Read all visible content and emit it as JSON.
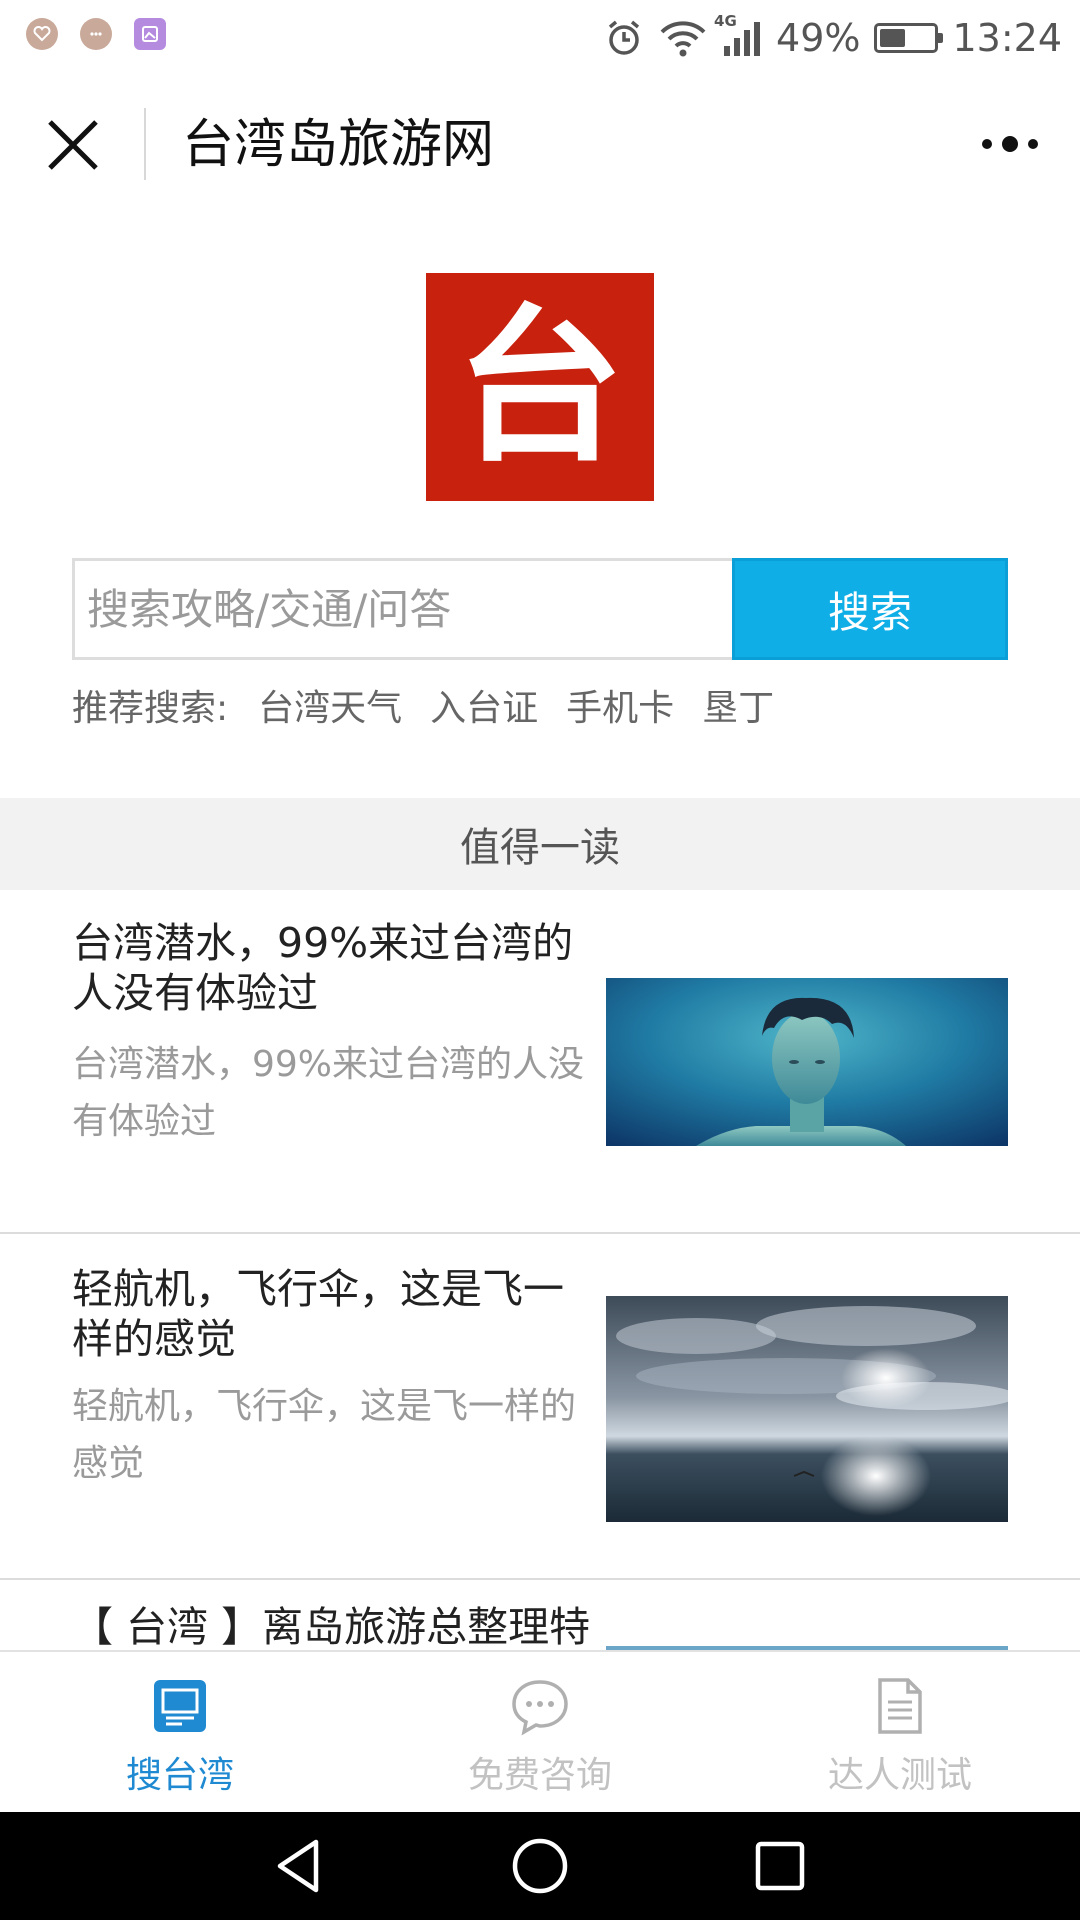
{
  "status_bar": {
    "network_tag": "4G",
    "battery_text": "49%",
    "battery_level": 0.49,
    "time": "13:24"
  },
  "title_bar": {
    "title": "台湾岛旅游网"
  },
  "logo": {
    "char": "台",
    "color": "#c8210e"
  },
  "search": {
    "placeholder": "搜索攻略/交通/问答",
    "button_label": "搜索",
    "button_color": "#10aee6"
  },
  "recommend": {
    "label": "推荐搜索:",
    "tags": [
      "台湾天气",
      "入台证",
      "手机卡",
      "垦丁"
    ]
  },
  "section": {
    "title": "值得一读"
  },
  "articles": [
    {
      "title": "台湾潜水，99%来过台湾的人没有体验过",
      "desc": "台湾潜水，99%来过台湾的人没有体验过"
    },
    {
      "title": "轻航机，飞行伞，这是飞一样的感觉",
      "desc": "轻航机，飞行伞，这是飞一样的感觉"
    },
    {
      "title": "【 台湾 】离岛旅游总整理特"
    }
  ],
  "tabbar": {
    "tabs": [
      {
        "label": "搜台湾",
        "icon": "monitor-icon",
        "active": true
      },
      {
        "label": "免费咨询",
        "icon": "chat-icon",
        "active": false
      },
      {
        "label": "达人测试",
        "icon": "document-icon",
        "active": false
      }
    ],
    "active_color": "#1f8ad2"
  }
}
